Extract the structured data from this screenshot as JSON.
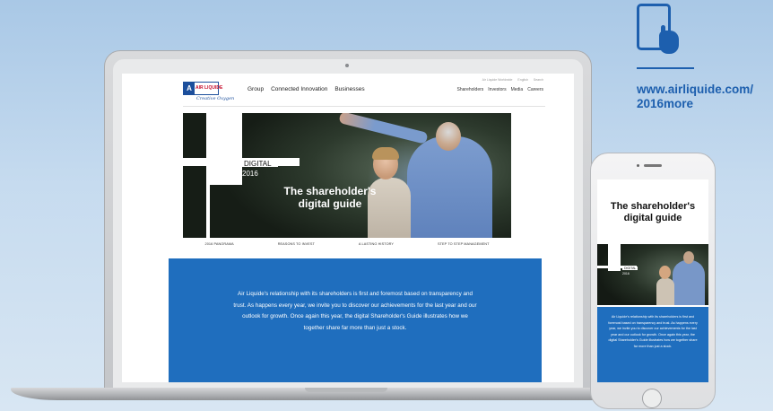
{
  "site": {
    "logo_text": "AIR LIQUIDE",
    "logo_mark": "A",
    "logo_tagline": "Creative Oxygen",
    "main_nav": [
      "Group",
      "Connected Innovation",
      "Businesses"
    ],
    "utility_nav": [
      "Air Liquide Worldwide",
      "English",
      "Search"
    ],
    "secondary_nav": [
      "Shareholders",
      "Investors",
      "Media",
      "Careers"
    ]
  },
  "hero": {
    "digital_label": "DIGITAL",
    "year_label": "2016",
    "title": "The shareholder's digital guide"
  },
  "tabs": [
    "2016 PANORAMA",
    "REASONS TO INVEST",
    "A LASTING HISTORY",
    "STEP TO STEP MANAGEMENT"
  ],
  "intro_text": "Air Liquide's relationship with its shareholders is first and foremost based on transparency and trust. As happens every year, we invite you to discover our achievements for the last year and our outlook for growth. Once again this year, the digital Shareholder's Guide illustrates how we together share far more than just a stock.",
  "phone": {
    "title": "The shareholder's digital guide",
    "digital_label": "DIGITAL",
    "year_label": "2016",
    "intro_text": "Air Liquide's relationship with its shareholders is first and foremost based on transparency and trust. As happens every year, we invite you to discover our achievements for the last year and our outlook for growth. Once again this year, the digital Shareholder's Guide illustrates how we together share far more than just a stock."
  },
  "promo": {
    "url": "www.airliquide.com/ 2016more",
    "icon": "tablet-touch-icon",
    "accent": "#1d5fae"
  }
}
